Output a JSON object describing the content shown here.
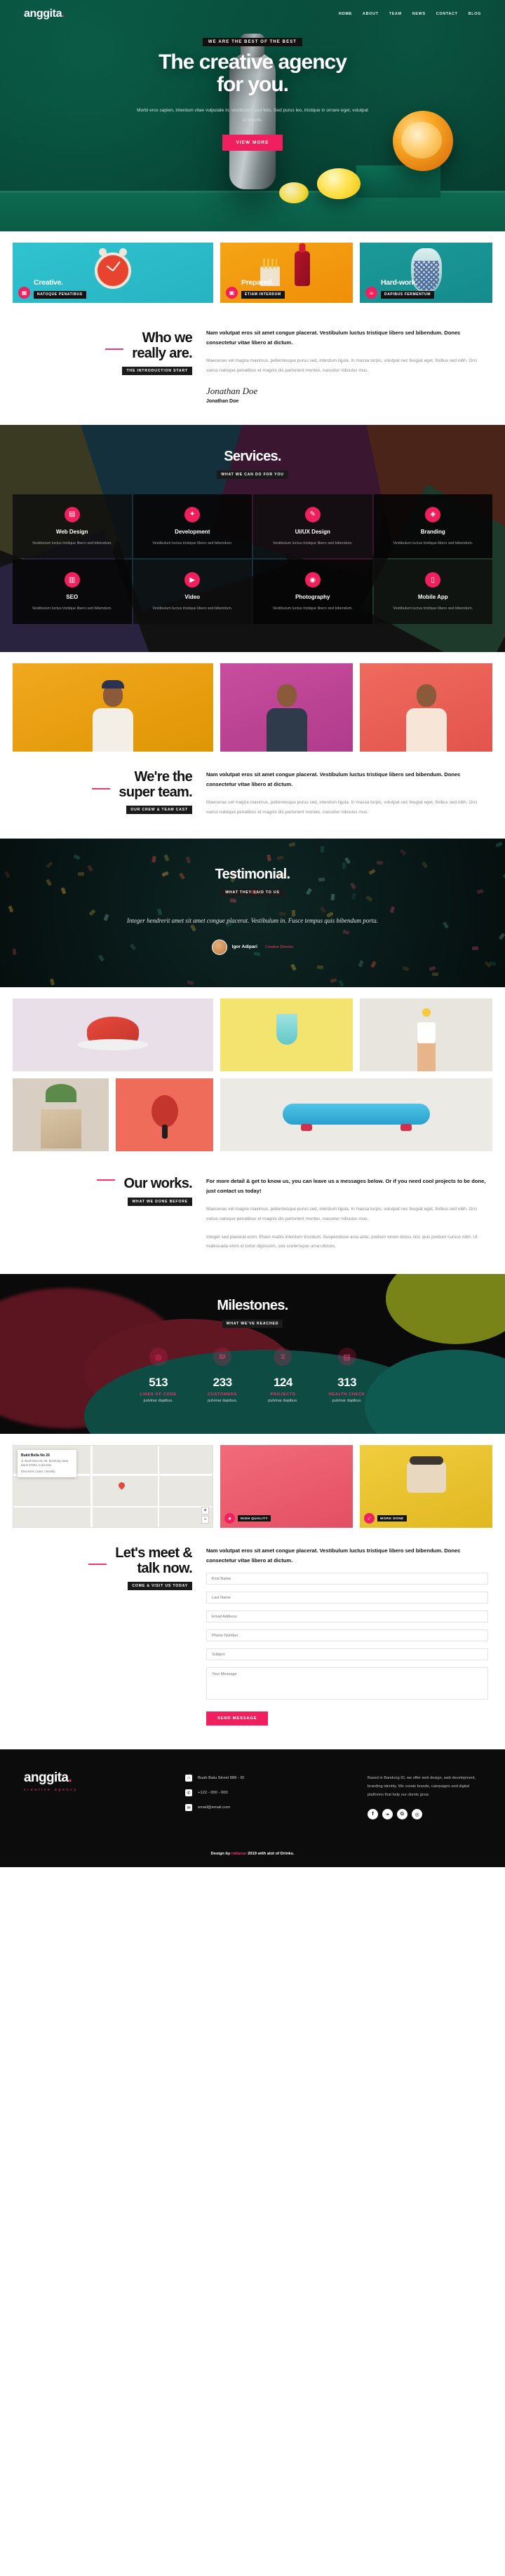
{
  "brand": {
    "name": "anggita",
    "dot": ".",
    "sub": "creative agency"
  },
  "nav": [
    {
      "label": "HOME",
      "active": true
    },
    {
      "label": "ABOUT",
      "active": false
    },
    {
      "label": "TEAM",
      "active": false
    },
    {
      "label": "NEWS",
      "active": false
    },
    {
      "label": "CONTACT",
      "active": false
    },
    {
      "label": "BLOG",
      "active": false
    }
  ],
  "hero": {
    "tagline": "WE ARE THE BEST OF THE BEST",
    "title_line1": "The creative agency",
    "title_line2": "for you.",
    "subtitle": "Morbi eros sapien, interdum vitae vulputate in, vestibulum sed felis. Sed purus leo, tristique in ornare eget, volutpat et mauris.",
    "cta": "VIEW MORE"
  },
  "features": [
    {
      "name": "Creative.",
      "tag": "NATOQUE PENATIBUS",
      "icon": "grid-icon"
    },
    {
      "name": "Prepared.",
      "tag": "ETIAM INTERDUM",
      "icon": "briefcase-icon"
    },
    {
      "name": "Hard-work.",
      "tag": "DAPIBUS FERMENTUM",
      "icon": "coffee-icon"
    }
  ],
  "about": {
    "title_line1": "Who we",
    "title_line2": "really are.",
    "tag": "THE INTRODUCTION START",
    "lead": "Nam volutpat eros sit amet congue placerat. Vestibulum luctus tristique libero sed bibendum. Donec consectetur vitae libero at dictum.",
    "paragraph": "Maecenas vel magna maximus, pellentesque purus sed, interdum ligula. In massa turpis, volutpat nec feugiat eget, finibus sed nibh. Orci varius natoque penatibus et magnis dis parturient montes, nascetur ridiculus mus.",
    "signature": "Jonathan Doe",
    "signature_name": "Jonathan Doe"
  },
  "services": {
    "title": "Services.",
    "tag": "WHAT WE CAN DO FOR YOU",
    "items": [
      {
        "name": "Web Design",
        "desc": "Vestibulum luctus tristique libero sed bibendum.",
        "icon": "file-icon"
      },
      {
        "name": "Development",
        "desc": "Vestibulum luctus tristique libero sed bibendum.",
        "icon": "code-icon"
      },
      {
        "name": "UI/UX Design",
        "desc": "Vestibulum luctus tristique libero sed bibendum.",
        "icon": "pen-icon"
      },
      {
        "name": "Branding",
        "desc": "Vestibulum luctus tristique libero sed bibendum.",
        "icon": "tag-icon"
      },
      {
        "name": "SEO",
        "desc": "Vestibulum luctus tristique libero sed bibendum.",
        "icon": "chart-icon"
      },
      {
        "name": "Video",
        "desc": "Vestibulum luctus tristique libero sed bibendum.",
        "icon": "play-icon"
      },
      {
        "name": "Photography",
        "desc": "Vestibulum luctus tristique libero sed bibendum.",
        "icon": "camera-icon"
      },
      {
        "name": "Mobile App",
        "desc": "Vestibulum luctus tristique libero sed bibendum.",
        "icon": "mobile-icon"
      }
    ]
  },
  "team": {
    "title_line1": "We're the",
    "title_line2": "super team.",
    "tag": "OUR CREW & TEAM CAST",
    "lead": "Nam volutpat eros sit amet congue placerat. Vestibulum luctus tristique libero sed bibendum. Donec consectetur vitae libero at dictum.",
    "paragraph": "Maecenas vel magna maximus, pellentesque purus sed, interdum ligula. In massa turpis, volutpat nec feugiat eget, finibus sed nibh. Orci varius natoque penatibus et magnis dis parturient montes, nascetur ridiculus mus."
  },
  "testimonial": {
    "title": "Testimonial.",
    "tag": "WHAT THEY SAID TO US",
    "quote": "Integer hendrerit amet sit amet congue placerat. Vestibulum in. Fusce tempus quis bibendum porta.",
    "author": "Igor Adipari",
    "role": "Creative Director"
  },
  "works": {
    "title_line1": "Our works.",
    "tag": "WHAT WE DONE BEFORE",
    "lead": "For more detail & get to know us, you can leave us a messages below. Or if you need cool projects to be done, just contact us today!",
    "paragraph1": "Maecenas vel magna maximus, pellentesque purus sed, interdum ligula. In massa turpis, volutpat nec feugiat eget, finibus sed nibh. Orci varius natoque penatibus et magnis dis parturient montes, nascetur ridiculus mus.",
    "paragraph2": "Integer sed placerat enim. Etiam mattis interdum tincidunt. Suspendisse arcu ante, pretium lorem dictus nisi, quis pretium cursus nibh. Ut malesuada enim id tortor dignissim, sed scelerisque urna ultrices."
  },
  "milestones": {
    "title": "Milestones.",
    "tag": "WHAT WE'VE REACHED",
    "items": [
      {
        "value": "513",
        "label": "LINES OF CODE",
        "sub": "pulvinar dapibus.",
        "icon": "target-icon"
      },
      {
        "value": "233",
        "label": "CUSTOMERS",
        "sub": "pulvinar dapibus.",
        "icon": "badge-icon"
      },
      {
        "value": "124",
        "label": "PROJECTS",
        "sub": "pulvinar dapibus.",
        "icon": "hourglass-icon"
      },
      {
        "value": "313",
        "label": "HEALTH CHECK",
        "sub": "pulvinar dapibus.",
        "icon": "clipboard-icon"
      }
    ]
  },
  "map": {
    "title": "Bukit Bella No 26",
    "address": "Jl. Buah Batu No 26, Bandung Jawa Barat 40264, Indonesia",
    "links": "Directions | Save | Nearby",
    "zoom_in": "+",
    "zoom_out": "−"
  },
  "media_badges": [
    {
      "tag": "HIGH QUALITY",
      "icon": "star-icon"
    },
    {
      "tag": "WORK DONE",
      "icon": "check-icon"
    }
  ],
  "contact": {
    "title_line1": "Let's meet &",
    "title_line2": "talk now.",
    "tag": "COME & VISIT US TODAY",
    "lead": "Nam volutpat eros sit amet congue placerat. Vestibulum luctus tristique libero sed bibendum. Donec consectetur vitae libero at dictum.",
    "first_name_placeholder": "First Name",
    "last_name_placeholder": "Last Name",
    "email_placeholder": "Email Address",
    "phone_placeholder": "Phone Number",
    "subject_placeholder": "Subject",
    "message_placeholder": "Your Message",
    "send_label": "SEND MESSAGE"
  },
  "footer": {
    "address": "Buah Batu Street 886 - ID",
    "phone": "+122 - 000 - 000",
    "email": "email@email.com",
    "about": "Based in Bandung ID, we offer web design, web development, branding identity. We create brands, campaigns and digital platforms that help our clients grow.",
    "socials": [
      {
        "name": "facebook-icon",
        "glyph": "f"
      },
      {
        "name": "twitter-icon",
        "glyph": "❧"
      },
      {
        "name": "google-plus-icon",
        "glyph": "G"
      },
      {
        "name": "instagram-icon",
        "glyph": "◎"
      }
    ],
    "credit_prefix": "Design by ",
    "credit_author": "ridianur",
    "credit_suffix": " 2019 with alot of Drinks."
  },
  "colors": {
    "accent": "#f01f5e",
    "hero_bg": "#064233",
    "dark": "#0c0c0c"
  }
}
